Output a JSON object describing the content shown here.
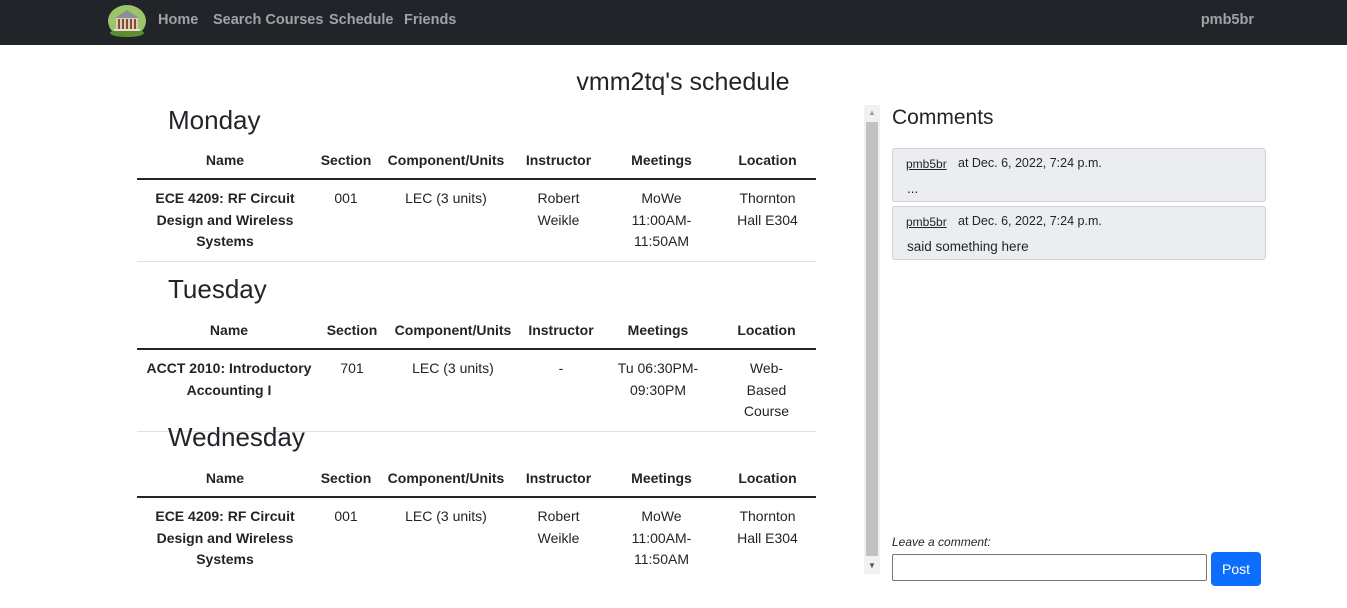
{
  "nav": {
    "links": [
      "Home",
      "Search Courses",
      "Schedule",
      "Friends"
    ],
    "user": "pmb5br"
  },
  "page_title": "vmm2tq's schedule",
  "columns": [
    "Name",
    "Section",
    "Component/Units",
    "Instructor",
    "Meetings",
    "Location"
  ],
  "days": [
    {
      "day": "Monday",
      "rows": [
        {
          "name": "ECE 4209: RF Circuit Design and Wireless Systems",
          "section": "001",
          "component": "LEC (3 units)",
          "instructor": "Robert Weikle",
          "meetings": "MoWe 11:00AM-11:50AM",
          "location": "Thornton Hall E304"
        }
      ]
    },
    {
      "day": "Tuesday",
      "rows": [
        {
          "name": "ACCT 2010: Introductory Accounting I",
          "section": "701",
          "component": "LEC (3 units)",
          "instructor": "-",
          "meetings": "Tu 06:30PM-09:30PM",
          "location": "Web-Based Course"
        }
      ]
    },
    {
      "day": "Wednesday",
      "rows": [
        {
          "name": "ECE 4209: RF Circuit Design and Wireless Systems",
          "section": "001",
          "component": "LEC (3 units)",
          "instructor": "Robert Weikle",
          "meetings": "MoWe 11:00AM-11:50AM",
          "location": "Thornton Hall E304"
        }
      ]
    }
  ],
  "comments": {
    "title": "Comments",
    "items": [
      {
        "user": "pmb5br",
        "time": "at Dec. 6, 2022, 7:24 p.m.",
        "text": "..."
      },
      {
        "user": "pmb5br",
        "time": "at Dec. 6, 2022, 7:24 p.m.",
        "text": "said something here"
      }
    ],
    "leave_label": "Leave a comment:",
    "input_value": "",
    "post_label": "Post"
  },
  "colors": {
    "navbar": "#212529",
    "post_button": "#0d6efd",
    "comment_bg": "#ecedf1"
  }
}
